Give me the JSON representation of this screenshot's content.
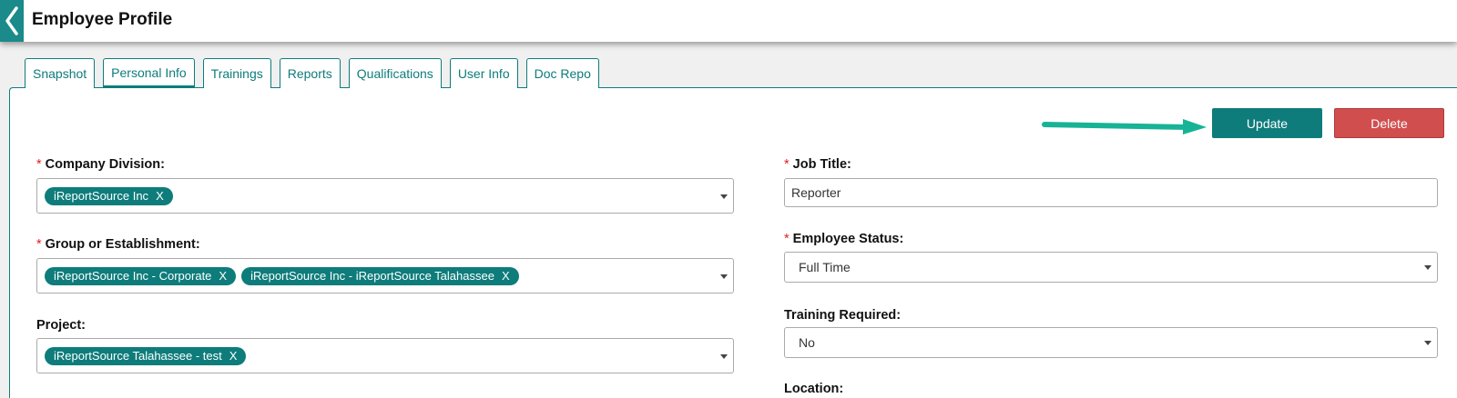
{
  "header": {
    "title": "Employee Profile"
  },
  "tabs": [
    {
      "label": "Snapshot"
    },
    {
      "label": "Personal Info"
    },
    {
      "label": "Trainings"
    },
    {
      "label": "Reports"
    },
    {
      "label": "Qualifications"
    },
    {
      "label": "User Info"
    },
    {
      "label": "Doc Repo"
    }
  ],
  "active_tab": "Personal Info",
  "actions": {
    "update_label": "Update",
    "delete_label": "Delete"
  },
  "colors": {
    "accent": "#0e7c7b",
    "danger": "#d14e4e",
    "required": "#e02020",
    "arrow": "#17b396"
  },
  "form": {
    "required_marker": "*",
    "company_division": {
      "label": "Company Division:",
      "chips": [
        "iReportSource Inc"
      ]
    },
    "group_establishment": {
      "label": "Group or Establishment:",
      "chips": [
        "iReportSource Inc - Corporate",
        "iReportSource Inc - iReportSource Talahassee"
      ]
    },
    "project": {
      "label": "Project:",
      "chips": [
        "iReportSource Talahassee - test"
      ]
    },
    "chip_remove": "X",
    "job_title": {
      "label": "Job Title:",
      "value": "Reporter"
    },
    "employee_status": {
      "label": "Employee Status:",
      "value": "Full Time"
    },
    "training_required": {
      "label": "Training Required:",
      "value": "No"
    },
    "location": {
      "label": "Location:"
    }
  }
}
